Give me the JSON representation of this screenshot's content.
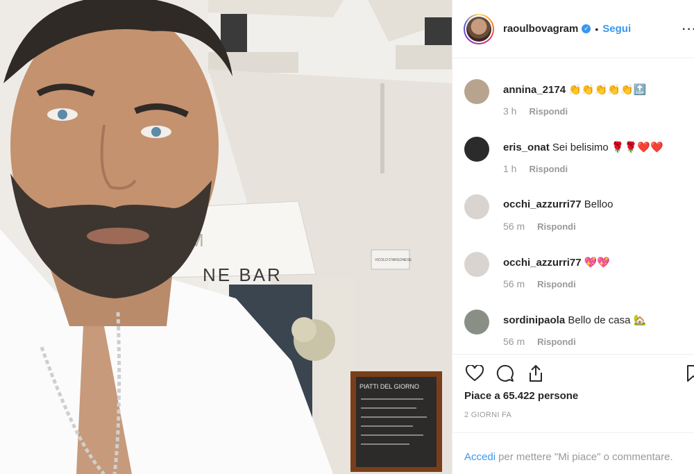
{
  "post": {
    "username": "raoulbovagram",
    "verified_icon": "verified-badge-icon",
    "separator": "•",
    "follow_label": "Segui",
    "more_icon": "more-options-icon"
  },
  "photo": {
    "sign_text": "NE BAR",
    "awning_text": "M",
    "plaque_text": "VICOLO D'ARGONESE",
    "menu_board_title": "PIATTI DEL GIORNO"
  },
  "comments": [
    {
      "user": "annina_2174",
      "text": "👏👏👏👏👏🔝",
      "time": "3 h",
      "reply": "Rispondi",
      "avatar_color": "#b8a48e"
    },
    {
      "user": "eris_onat",
      "text": "Sei belisimo 🌹🌹❤️❤️",
      "time": "1 h",
      "reply": "Rispondi",
      "avatar_color": "#2b2b2b"
    },
    {
      "user": "occhi_azzurri77",
      "text": "Belloo",
      "time": "56 m",
      "reply": "Rispondi",
      "avatar_color": "#d9d4cf"
    },
    {
      "user": "occhi_azzurri77",
      "text": "💖💖",
      "time": "56 m",
      "reply": "Rispondi",
      "avatar_color": "#d9d4cf"
    },
    {
      "user": "sordinipaola",
      "text": "Bello de casa 🏡",
      "time": "56 m",
      "reply": "Rispondi",
      "avatar_color": "#8a8f86"
    }
  ],
  "actions": {
    "like_icon": "heart-icon",
    "comment_icon": "comment-icon",
    "share_icon": "share-icon",
    "save_icon": "bookmark-icon",
    "likes_text": "Piace a 65.422 persone",
    "date_text": "2 GIORNI FA"
  },
  "login": {
    "link": "Accedi",
    "text": "per mettere \"Mi piace\" o commentare."
  },
  "colors": {
    "accent": "#3897f0",
    "text": "#262626",
    "muted": "#999999",
    "border": "#efefef"
  }
}
